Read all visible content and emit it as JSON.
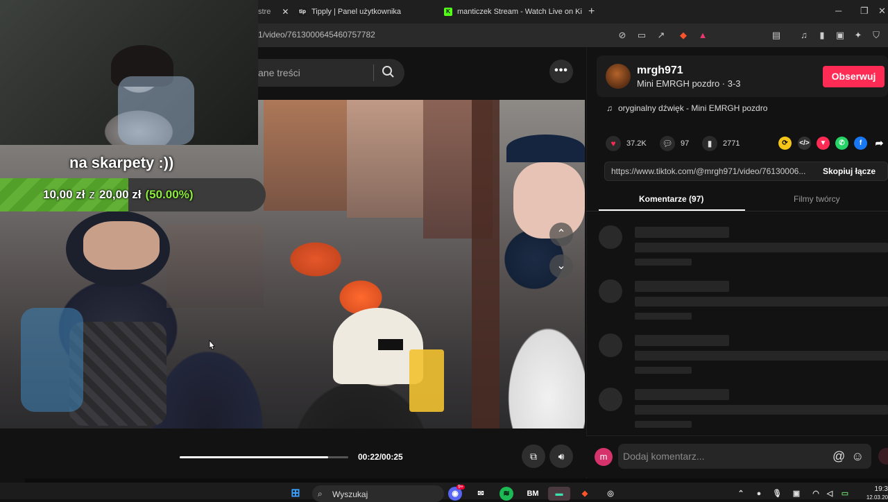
{
  "browser": {
    "tabs": [
      {
        "label": "stre",
        "favicon": "tiktok-icon"
      },
      {
        "label": "Tipply | Panel użytkownika",
        "favicon": "tipply-icon"
      },
      {
        "label": "manticzek Stream - Watch Live on Ki",
        "favicon": "kick-icon"
      }
    ],
    "url": "1/video/7613000645460757782"
  },
  "search": {
    "placeholder": "ane treści"
  },
  "overlay": {
    "donation_title": "na skarpety :))",
    "goal_current": "10,00 zł",
    "goal_sep": "z",
    "goal_target": "20,00 zł",
    "goal_percent": "(50.00%)",
    "goal_fraction": 0.5
  },
  "player": {
    "time": "00:22/00:25",
    "progress_fraction": 0.88
  },
  "author": {
    "username": "mrgh971",
    "subline": "Mini EMRGH pozdro · 3-3",
    "follow_label": "Obserwuj"
  },
  "sound": {
    "label": "oryginalny dźwięk - Mini EMRGH pozdro"
  },
  "stats": {
    "likes": "37.2K",
    "comments": "97",
    "saves": "2771"
  },
  "link": {
    "url": "https://www.tiktok.com/@mrgh971/video/76130006...",
    "copy_label": "Skopiuj łącze"
  },
  "tabs": {
    "comments": "Komentarze (97)",
    "creator_videos": "Filmy twórcy"
  },
  "comment_box": {
    "avatar_letter": "m",
    "placeholder": "Dodaj komentarz..."
  },
  "taskbar": {
    "search_label": "Wyszukaj",
    "time": "19:3",
    "date": "12.03.20",
    "discord_badge": "9+"
  },
  "colors": {
    "accent": "#fe2c55",
    "goal_green": "#62b136",
    "goal_percent": "#8dec3b"
  }
}
